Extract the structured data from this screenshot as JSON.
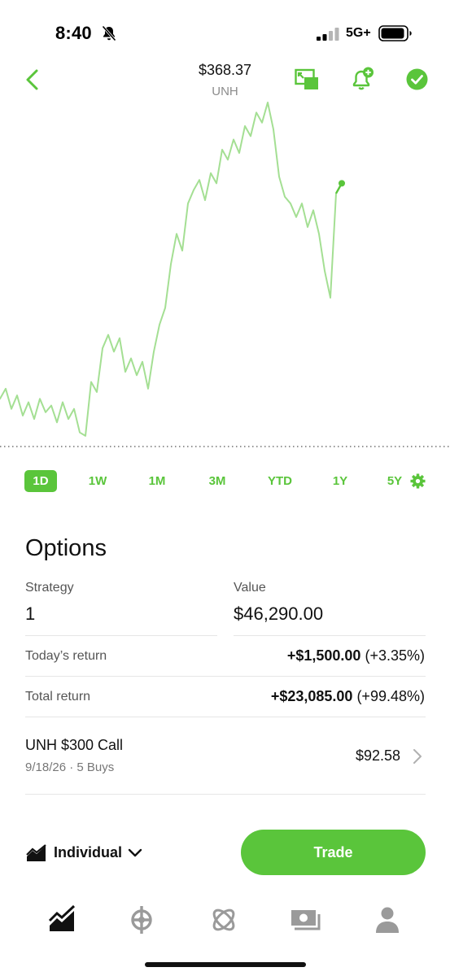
{
  "status_bar": {
    "time": "8:40",
    "network": "5G+"
  },
  "header": {
    "price": "$368.37",
    "ticker": "UNH",
    "back_icon": "chevron-left-icon",
    "pip_icon": "picture-in-picture-icon",
    "alert_icon": "bell-add-icon",
    "watch_icon": "checkmark-circle-icon"
  },
  "chart_data": {
    "type": "line",
    "color": "#5ac53b",
    "baseline": "dotted",
    "x": [
      0,
      1,
      2,
      3,
      4,
      5,
      6,
      7,
      8,
      9,
      10,
      11,
      12,
      13,
      14,
      15,
      16,
      17,
      18,
      19,
      20,
      21,
      22,
      23,
      24,
      25,
      26,
      27,
      28,
      29,
      30,
      31,
      32,
      33,
      34,
      35,
      36,
      37,
      38,
      39,
      40,
      41,
      42,
      43,
      44,
      45,
      46,
      47,
      48,
      49,
      50,
      51,
      52,
      53,
      54,
      55,
      56,
      57,
      58,
      59,
      60,
      61,
      62,
      63,
      64,
      65,
      66,
      67,
      68,
      69,
      70,
      71,
      72,
      73,
      74,
      75,
      76,
      77,
      78,
      79
    ],
    "values": [
      0.12,
      0.15,
      0.09,
      0.13,
      0.07,
      0.11,
      0.06,
      0.12,
      0.08,
      0.1,
      0.05,
      0.11,
      0.06,
      0.09,
      0.02,
      0.01,
      0.17,
      0.14,
      0.27,
      0.31,
      0.26,
      0.3,
      0.2,
      0.24,
      0.19,
      0.23,
      0.15,
      0.26,
      0.34,
      0.39,
      0.52,
      0.61,
      0.56,
      0.7,
      0.74,
      0.77,
      0.71,
      0.79,
      0.76,
      0.86,
      0.83,
      0.89,
      0.85,
      0.93,
      0.9,
      0.97,
      0.94,
      1.0,
      0.92,
      0.78,
      0.72,
      0.7,
      0.66,
      0.7,
      0.63,
      0.68,
      0.61,
      0.5,
      0.42,
      0.73,
      0.76
    ],
    "marker_last": true
  },
  "ranges": {
    "items": [
      "1D",
      "1W",
      "1M",
      "3M",
      "YTD",
      "1Y",
      "5Y"
    ],
    "active": "1D"
  },
  "options": {
    "title": "Options",
    "strategy_label": "Strategy",
    "strategy_value": "1",
    "value_label": "Value",
    "value_value": "$46,290.00",
    "todays_return_label": "Today’s return",
    "todays_return_amount": "+$1,500.00",
    "todays_return_pct": "(+3.35%)",
    "total_return_label": "Total return",
    "total_return_amount": "+$23,085.00",
    "total_return_pct": "(+99.48%)"
  },
  "position": {
    "name": "UNH $300 Call",
    "detail": "9/18/26 · 5 Buys",
    "value": "$92.58"
  },
  "account": {
    "label": "Individual",
    "trade_label": "Trade"
  },
  "tabbar": {
    "items": [
      "investing-icon",
      "crypto-icon",
      "browse-icon",
      "cash-icon",
      "account-icon"
    ]
  },
  "colors": {
    "accent": "#5ac53b",
    "text": "#111111",
    "muted": "#777777"
  }
}
